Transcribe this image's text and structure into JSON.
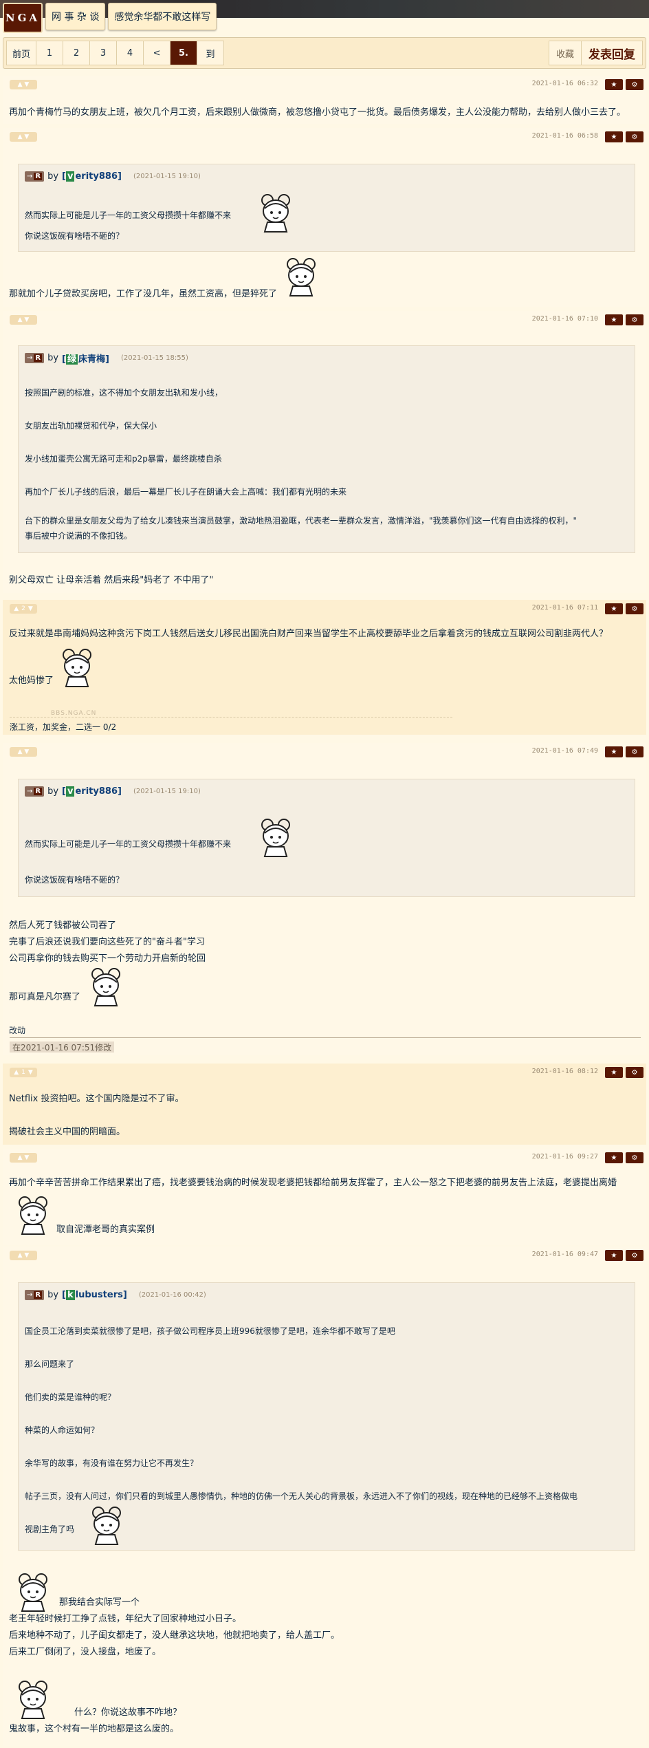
{
  "topbar": {
    "logo": "NGA",
    "forum": "网 事 杂 谈",
    "thread": "感觉余华都不敢这样写"
  },
  "pager": {
    "first": "前页",
    "pages": [
      "1",
      "2",
      "3",
      "4"
    ],
    "prev": "<",
    "current": "5.",
    "go": "到",
    "favorite": "收藏",
    "reply": "发表回复"
  },
  "posts": [
    {
      "votes": "",
      "time": "2021-01-16 06:32",
      "lines": [
        "再加个青梅竹马的女朋友上班，被欠几个月工资，后来跟别人做微商，被忽悠撸小贷屯了一批货。最后债务爆发，主人公没能力帮助，去给别人做小三去了。"
      ]
    },
    {
      "votes": "",
      "time": "2021-01-16 06:58",
      "quote": {
        "tag": "R",
        "by": "by",
        "user_badge": "v",
        "user": "erity886",
        "time": "(2021-01-15 19:10)",
        "lines": [
          "然而实际上可能是儿子一年的工资父母攒攒十年都赚不来",
          "你说这饭碗有啥唔不砸的？"
        ]
      },
      "lines": [
        "那就加个儿子贷款买房吧，工作了没几年，虽然工资高，但是猝死了"
      ]
    },
    {
      "votes": "",
      "time": "2021-01-16 07:10",
      "quote": {
        "tag": "R",
        "by": "by",
        "user_badge": "绿",
        "user": "床青梅",
        "time": "(2021-01-15 18:55)",
        "lines": [
          "按照国产剧的标准，这不得加个女朋友出轨和发小线，",
          "女朋友出轨加裸贷和代孕，保大保小",
          "发小线加蛋壳公寓无路可走和p2p暴雷，最终跳楼自杀",
          "再加个厂长儿子线的后浪，最后一幕是厂长儿子在朗诵大会上高喊：我们都有光明的未来",
          "台下的群众里是女朋友父母为了给女儿凑钱来当演员鼓掌，激动地热泪盈眶，代表老一辈群众发言，激情洋溢，\"我羡慕你们这一代有自由选择的权利，\"",
          "事后被中介说满的不像扣钱。"
        ]
      },
      "lines": [
        "别父母双亡 让母亲活着 然后来段\"妈老了 不中用了\""
      ]
    },
    {
      "votes": "2",
      "time": "2021-01-16 07:11",
      "lines": [
        "反过来就是串南埔妈妈这种贪污下岗工人钱然后送女儿移民出国洗白财产回来当留学生不止高校要舔毕业之后拿着贪污的钱成立互联网公司割韭两代人？",
        "太他妈惨了"
      ],
      "watermark": "BBS.NGA.CN",
      "signature": "涨工资，加奖金，二选一 0/2"
    },
    {
      "votes": "",
      "time": "2021-01-16 07:49",
      "quote": {
        "tag": "R",
        "by": "by",
        "user_badge": "v",
        "user": "erity886",
        "time": "(2021-01-15 19:10)",
        "lines": [
          "然而实际上可能是儿子一年的工资父母攒攒十年都赚不来",
          "你说这饭碗有啥唔不砸的？"
        ]
      },
      "lines": [
        "然后人死了钱都被公司吞了",
        "完事了后浪还说我们要向这些死了的\"奋斗者\"学习",
        "公司再拿你的钱去购买下一个劳动力开启新的轮回",
        "那可真是凡尔赛了"
      ],
      "edit_label": "改动",
      "edit_time": "在2021-01-16 07:51修改"
    },
    {
      "votes": "1",
      "time": "2021-01-16 08:12",
      "lines": [
        "Netflix 投资拍吧。这个国内隐是过不了审。",
        "揭破社会主义中国的阴暗面。"
      ]
    },
    {
      "votes": "",
      "time": "2021-01-16 09:27",
      "lines": [
        "再加个辛辛苦苦拼命工作结果累出了癌，找老婆要钱治病的时候发现老婆把钱都给前男友挥霍了，主人公一怒之下把老婆的前男友告上法庭，老婆提出离婚",
        "取自泥潭老哥的真实案例"
      ]
    },
    {
      "votes": "",
      "time": "2021-01-16 09:47",
      "quote": {
        "tag": "R",
        "by": "by",
        "user_badge": "k",
        "user": "lubusters",
        "time": "(2021-01-16 00:42)",
        "lines": [
          "国企员工沦落到卖菜就很惨了是吧，孩子做公司程序员上班996就很惨了是吧，连余华都不敢写了是吧",
          "那么问题来了",
          "他们卖的菜是谁种的呢？",
          "种菜的人命运如何？",
          "余华写的故事，有没有谁在努力让它不再发生？",
          "帖子三页，没有人问过，你们只看的到城里人愚惨情仇，种地的仿佛一个无人关心的背景板，永远进入不了你们的视线，现在种地的已经够不上资格做电",
          "视剧主角了吗"
        ]
      },
      "lines": [
        "那我结合实际写一个",
        "老王年轻时候打工挣了点钱，年纪大了回家种地过小日子。",
        "后来地种不动了，儿子闺女都走了，没人继承这块地，他就把地卖了，给人盖工厂。",
        "后来工厂倒闭了，没人接盘，地废了。",
        "什么？你说这故事不咋地？",
        "鬼故事，这个村有一半的地都是这么废的。"
      ]
    }
  ]
}
